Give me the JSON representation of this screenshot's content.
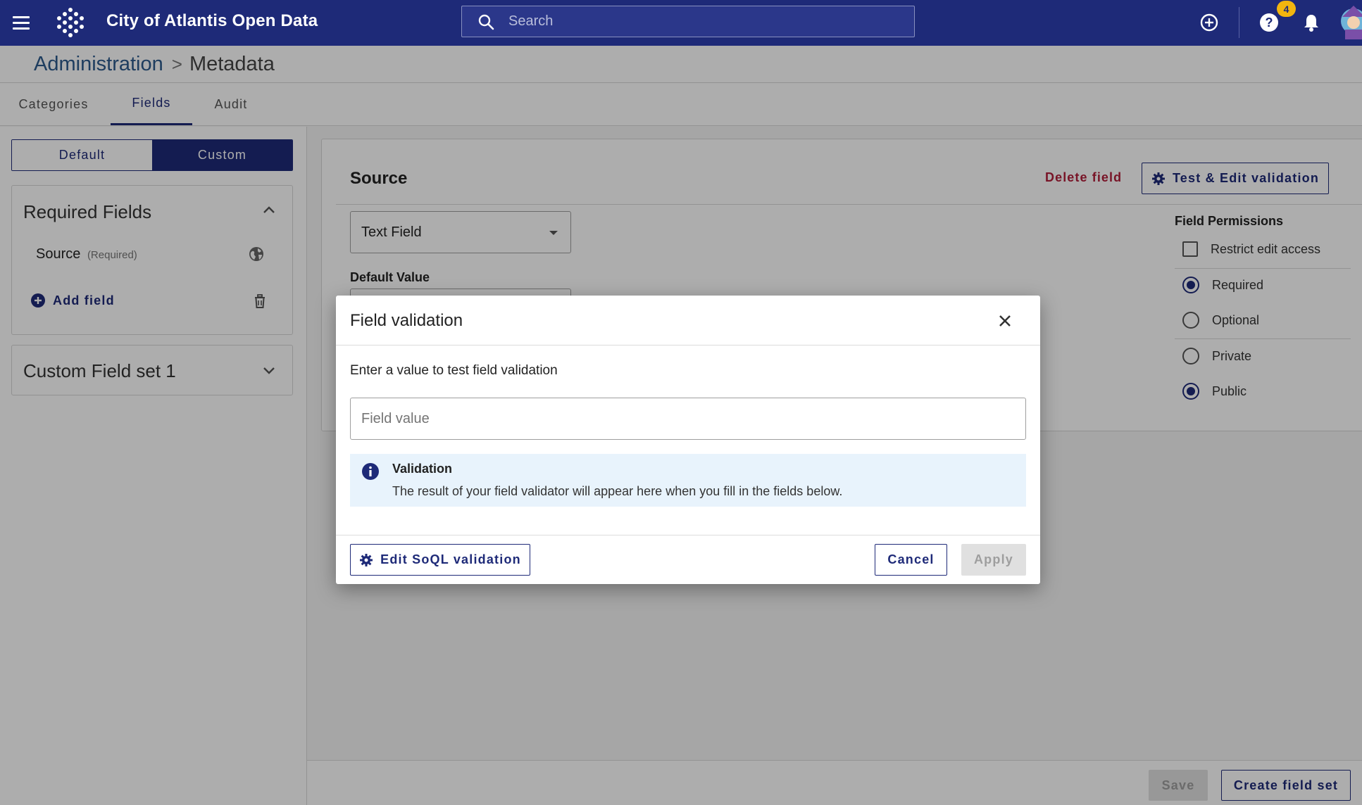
{
  "app": {
    "title": "City of Atlantis Open Data",
    "brand_color": "#1e2a78",
    "search_placeholder": "Search",
    "notification_count": "4"
  },
  "breadcrumb": {
    "parent": "Administration",
    "separator": ">",
    "current": "Metadata"
  },
  "tabs": [
    {
      "label": "Categories",
      "active": false
    },
    {
      "label": "Fields",
      "active": true
    },
    {
      "label": "Audit",
      "active": false
    }
  ],
  "sidebar": {
    "toggle": {
      "default_label": "Default",
      "custom_label": "Custom",
      "selected": "Custom"
    },
    "required_panel": {
      "title": "Required Fields",
      "expanded": true,
      "fields": [
        {
          "name": "Source",
          "tag": "(Required)",
          "icon": "globe-icon"
        }
      ],
      "add_label": "Add field"
    },
    "custom_panel": {
      "title": "Custom Field set 1",
      "expanded": false
    }
  },
  "field_editor": {
    "title": "Source",
    "delete_label": "Delete field",
    "test_label": "Test & Edit validation",
    "type_value": "Text Field",
    "default_value_label": "Default Value",
    "permissions": {
      "title": "Field Permissions",
      "restrict_label": "Restrict edit access",
      "restrict_checked": false,
      "required_label": "Required",
      "optional_label": "Optional",
      "requirement": "Required",
      "private_label": "Private",
      "public_label": "Public",
      "visibility": "Public"
    }
  },
  "footer": {
    "save_label": "Save",
    "create_label": "Create field set"
  },
  "modal": {
    "title": "Field validation",
    "prompt": "Enter a value to test field validation",
    "input_placeholder": "Field value",
    "info_title": "Validation",
    "info_text": "The result of your field validator will appear here when you fill in the fields below.",
    "soql_label": "Edit SoQL validation",
    "cancel_label": "Cancel",
    "apply_label": "Apply"
  }
}
